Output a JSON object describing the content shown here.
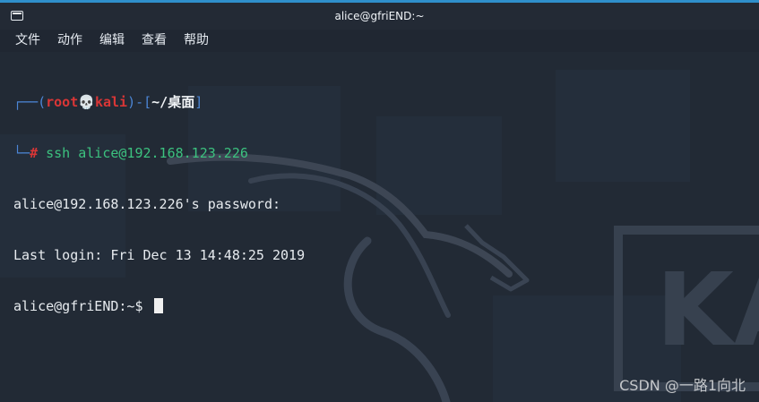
{
  "window": {
    "title": "alice@gfriEND:~",
    "icon": "terminal-icon",
    "accent_color": "#2f8fcb"
  },
  "menubar": {
    "items": [
      {
        "label": "文件"
      },
      {
        "label": "动作"
      },
      {
        "label": "编辑"
      },
      {
        "label": "查看"
      },
      {
        "label": "帮助"
      }
    ]
  },
  "terminal": {
    "prompt": {
      "prefix": "┌──(",
      "user": "root",
      "skull": "💀",
      "host": "kali",
      "middle": ")-[",
      "path": "~/桌面",
      "suffix": "]",
      "second_prefix": "└─",
      "hash": "#",
      "command": " ssh alice@192.168.123.226"
    },
    "output": [
      "alice@192.168.123.226's password:",
      "Last login: Fri Dec 13 14:48:25 2019"
    ],
    "current_prompt": "alice@gfriEND:~$ "
  },
  "background": {
    "logo_text": "KA"
  },
  "watermark": "CSDN @一路1向北",
  "colors": {
    "background": "#222a35",
    "text": "#e7ebef",
    "prompt_blue": "#4c86d6",
    "prompt_red": "#d93636",
    "command_green": "#3cc27f"
  }
}
